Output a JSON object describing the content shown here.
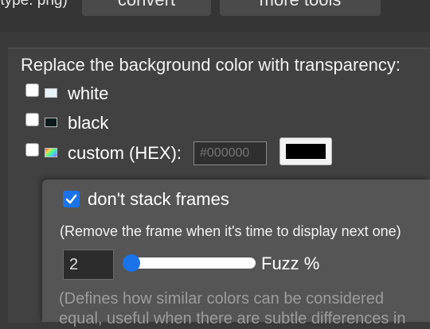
{
  "top": {
    "label": "(type: png)",
    "convert_label": "convert",
    "more_tools_label": "more tools"
  },
  "transparency": {
    "heading": "Replace the background color with transparency:",
    "options": [
      {
        "label": "white",
        "checked": false,
        "swatch": "#e8f4f8"
      },
      {
        "label": "black",
        "checked": false,
        "swatch": "#0b1a1a"
      },
      {
        "label": "custom (HEX):",
        "checked": false,
        "swatch": "rainbow"
      }
    ],
    "hex_placeholder": "#000000",
    "picker_color": "#000000"
  },
  "frames": {
    "dont_stack_label": "don't stack frames",
    "dont_stack_checked": true,
    "remove_note": "(Remove the frame when it's time to display next one)"
  },
  "fuzz": {
    "value": "2",
    "label": "Fuzz %",
    "note": "(Defines how similar colors can be considered equal, useful when there are subtle differences in"
  },
  "colors": {
    "accent": "#1a73e8",
    "page_bg": "#3a3a3a",
    "popup_bg": "#555555"
  }
}
